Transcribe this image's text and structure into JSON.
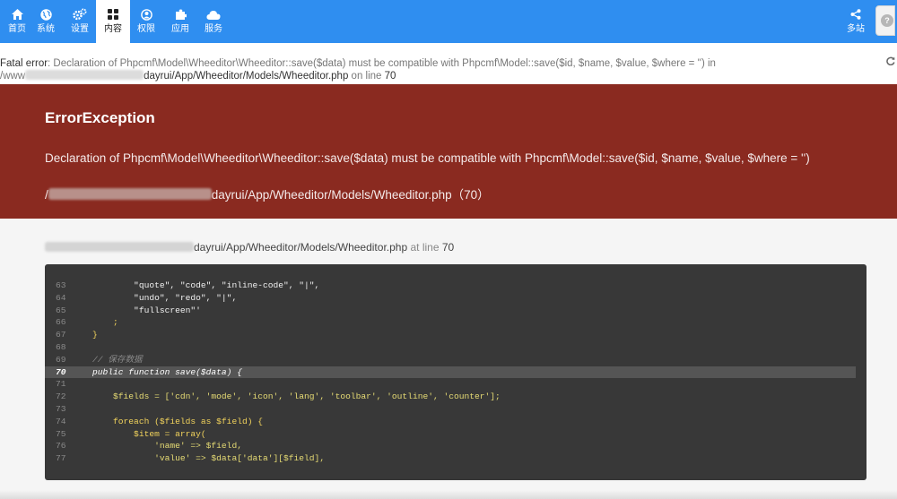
{
  "navbar": {
    "items": [
      {
        "label": "首页",
        "icon": "home-icon"
      },
      {
        "label": "系统",
        "icon": "globe-icon"
      },
      {
        "label": "设置",
        "icon": "gears-icon"
      },
      {
        "label": "内容",
        "icon": "grid-icon",
        "active": true
      },
      {
        "label": "权限",
        "icon": "user-icon"
      },
      {
        "label": "应用",
        "icon": "puzzle-icon"
      },
      {
        "label": "服务",
        "icon": "cloud-icon"
      }
    ],
    "right_item": {
      "label": "多站",
      "icon": "share-icon"
    },
    "accent_color": "#2f8ef0"
  },
  "fatal": {
    "label": "Fatal error",
    "message": ": Declaration of Phpcmf\\Model\\Wheeditor\\Wheeditor::save($data) must be compatible with Phpcmf\\Model::save($id, $name, $value, $where = '') in",
    "path_prefix": "/www",
    "path": "dayrui/App/Wheeditor/Models/Wheeditor.php",
    "on_line_label": "on line",
    "line": "70"
  },
  "exception": {
    "title": "ErrorException",
    "message": "Declaration of Phpcmf\\Model\\Wheeditor\\Wheeditor::save($data) must be compatible with Phpcmf\\Model::save($id, $name, $value, $where = '')",
    "path_prefix": "/",
    "path": "dayrui/App/Wheeditor/Models/Wheeditor.php（70）",
    "bg_color": "#8a2a20"
  },
  "trace": {
    "path": "dayrui/App/Wheeditor/Models/Wheeditor.php",
    "at_line_label": "at line",
    "line": "70"
  },
  "code_lines": [
    {
      "n": "63",
      "text": "        \"quote\", \"code\", \"inline-code\", \"|\","
    },
    {
      "n": "64",
      "text": "        \"undo\", \"redo\", \"|\","
    },
    {
      "n": "65",
      "text": "        \"fullscreen\"'"
    },
    {
      "n": "66",
      "text": "    ;"
    },
    {
      "n": "67",
      "text": "}"
    },
    {
      "n": "68",
      "text": ""
    },
    {
      "n": "69",
      "text": "// 保存数据"
    },
    {
      "n": "70",
      "text": "public function save($data) {",
      "highlight": true
    },
    {
      "n": "71",
      "text": ""
    },
    {
      "n": "72",
      "text": "    $fields = ['cdn', 'mode', 'icon', 'lang', 'toolbar', 'outline', 'counter'];"
    },
    {
      "n": "73",
      "text": ""
    },
    {
      "n": "74",
      "text": "    foreach ($fields as $field) {"
    },
    {
      "n": "75",
      "text": "        $item = array("
    },
    {
      "n": "76",
      "text": "            'name' => $field,"
    },
    {
      "n": "77",
      "text": "            'value' => $data['data'][$field],"
    }
  ]
}
